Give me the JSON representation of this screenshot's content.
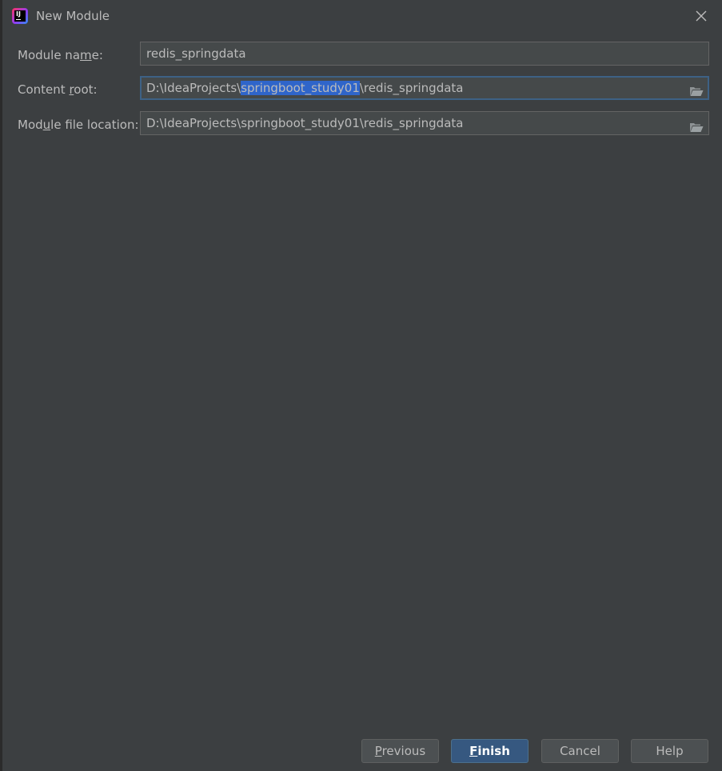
{
  "window": {
    "title": "New Module",
    "app_icon_text": "IJ"
  },
  "form": {
    "module_name": {
      "label_pre": "Module na",
      "label_mn": "m",
      "label_post": "e:",
      "value": "redis_springdata"
    },
    "content_root": {
      "label_pre": "Content ",
      "label_mn": "r",
      "label_post": "oot:",
      "value_pre": "D:\\IdeaProjects\\",
      "value_selected": "springboot_study01",
      "value_post": "\\redis_springdata"
    },
    "module_file_location": {
      "label_pre": "Mod",
      "label_mn": "u",
      "label_post": "le file location:",
      "value": "D:\\IdeaProjects\\springboot_study01\\redis_springdata"
    }
  },
  "buttons": {
    "previous": {
      "mn": "P",
      "rest": "revious"
    },
    "finish": {
      "mn": "F",
      "rest": "inish"
    },
    "cancel": "Cancel",
    "help": "Help"
  },
  "icons": {
    "close": "close-icon",
    "folder": "folder-open-icon",
    "app": "intellij-idea-icon"
  },
  "colors": {
    "background": "#3c3f41",
    "field_bg": "#45494a",
    "focus_border": "#3d6185",
    "selection": "#2f65ca",
    "primary_button": "#365880"
  }
}
